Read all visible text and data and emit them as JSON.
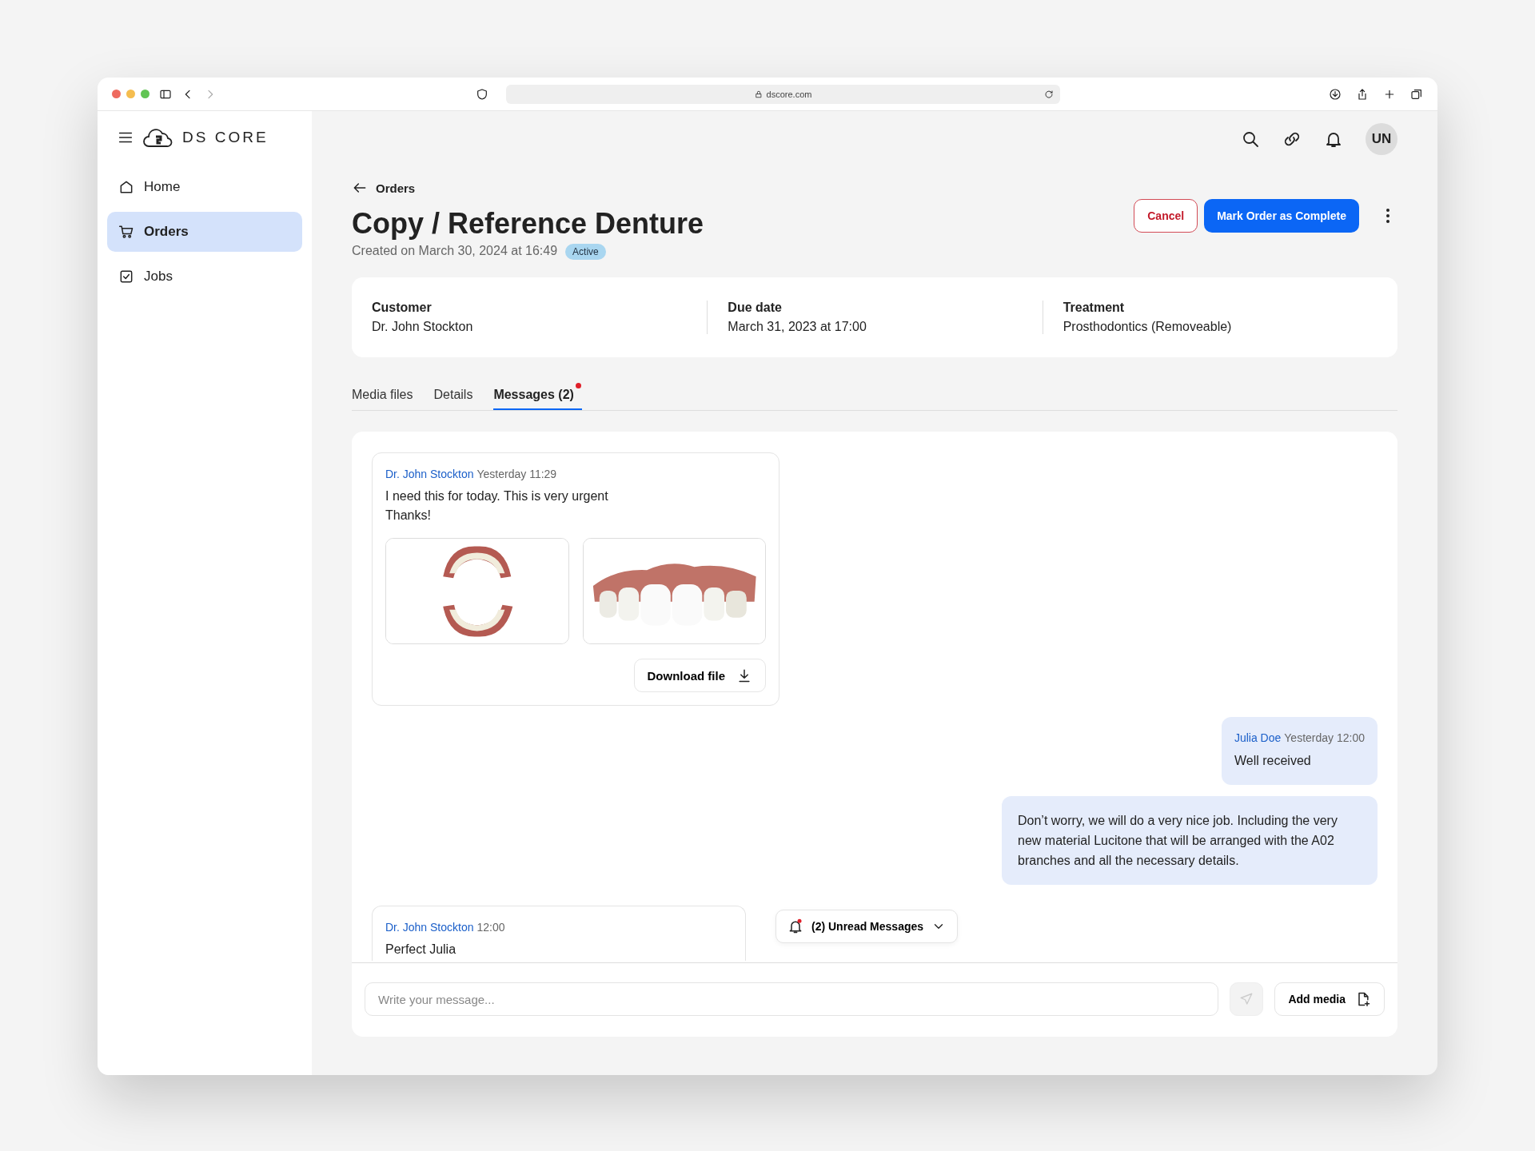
{
  "browser": {
    "url": "dscore.com"
  },
  "sidebar": {
    "brand": "DS CORE",
    "items": [
      {
        "label": "Home",
        "selected": false
      },
      {
        "label": "Orders",
        "selected": true
      },
      {
        "label": "Jobs",
        "selected": false
      }
    ]
  },
  "topbar": {
    "avatar": "UN"
  },
  "header": {
    "back": "Orders",
    "title": "Copy / Reference Denture",
    "created": "Created on March 30, 2024 at 16:49",
    "status": "Active",
    "cancel": "Cancel",
    "complete": "Mark Order as Complete"
  },
  "info": [
    {
      "label": "Customer",
      "value": "Dr. John Stockton"
    },
    {
      "label": "Due date",
      "value": "March 31, 2023 at 17:00"
    },
    {
      "label": "Treatment",
      "value": "Prosthodontics (Removeable)"
    }
  ],
  "tabs": [
    {
      "label": "Media files",
      "selected": false,
      "unread": false
    },
    {
      "label": "Details",
      "selected": false,
      "unread": false
    },
    {
      "label": "Messages (2)",
      "selected": true,
      "unread": true
    }
  ],
  "messages": [
    {
      "kind": "incoming",
      "author": "Dr. John Stockton",
      "time": "Yesterday 11:29",
      "lines": [
        "I need this for today. This is very urgent",
        "Thanks!"
      ],
      "attachments": [
        {
          "kind": "picture"
        },
        {
          "kind": "picture"
        }
      ],
      "download": "Download file"
    },
    {
      "kind": "outgoing",
      "author": "Julia Doe",
      "time": "Yesterday 12:00",
      "lines": [
        "Well received"
      ]
    },
    {
      "kind": "outgoing",
      "lines": [
        "Don’t worry, we will do a very nice job. Including the very new material Lucitone that will be arranged with the A02 branches and all the necessary details."
      ]
    },
    {
      "kind": "incoming",
      "author": "Dr. John Stockton",
      "time": "12:00",
      "lines": [
        "Perfect Julia"
      ]
    }
  ],
  "unread_button": {
    "label": "(2) Unread Messages"
  },
  "composer": {
    "placeholder": "Write your message...",
    "add_media": "Add media"
  }
}
